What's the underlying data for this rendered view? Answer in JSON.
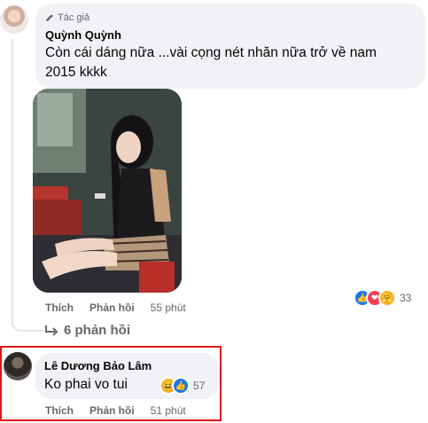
{
  "comment_1": {
    "author_tag": "Tác giả",
    "author": "Quỳnh Quỳnh",
    "text": "Còn cái dáng nữa ...vài cọng nét nhăn nữa trở về nam 2015 kkkk",
    "photo": "attached-photo",
    "actions": {
      "like": "Thích",
      "reply": "Phản hồi",
      "time": "55 phút"
    },
    "reactions": {
      "icons": [
        "like-icon",
        "love-icon",
        "care-icon"
      ],
      "count": "33"
    }
  },
  "more_replies": {
    "label": "6 phản hồi"
  },
  "comment_2": {
    "author": "Lê Dương Bảo Lâm",
    "text": "Ko phai vo tui",
    "actions": {
      "like": "Thích",
      "reply": "Phản hồi",
      "time": "51 phút"
    },
    "reactions": {
      "icons": [
        "haha-icon",
        "like-icon"
      ],
      "count": "57"
    }
  },
  "colors": {
    "highlight": "#e0151a",
    "bubble": "#f0f2f5",
    "like": "#1877f2",
    "love": "#f33e58"
  }
}
